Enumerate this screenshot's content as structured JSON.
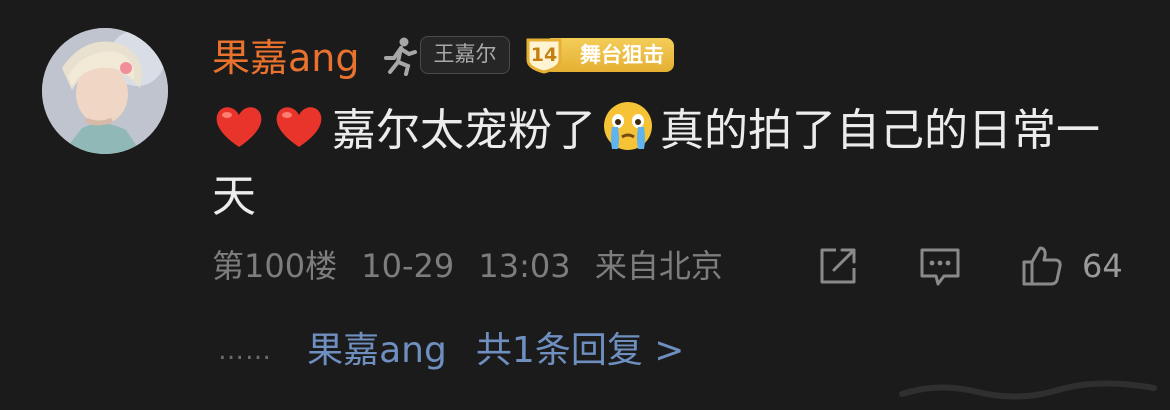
{
  "comment": {
    "username": "果嘉ang",
    "badge_tag": "王嘉尔",
    "badge_level_number": "14",
    "badge_level_label": "舞台狙击",
    "text_part1": "嘉尔太宠粉了",
    "text_part2": "真的拍了自己的日常一天",
    "emoji_heart": "red-heart",
    "emoji_cry": "crying-face",
    "floor": "第100楼",
    "date": "10-29",
    "time": "13:03",
    "location": "来自北京",
    "like_count": "64"
  },
  "reply_preview": {
    "dots": "……",
    "username": "果嘉ang",
    "count_text": "共1条回复 >"
  },
  "colors": {
    "background": "#1b1b1b",
    "username": "#e8722e",
    "reply_link": "#6e8fbf",
    "badge_gold": "#e5b033"
  }
}
